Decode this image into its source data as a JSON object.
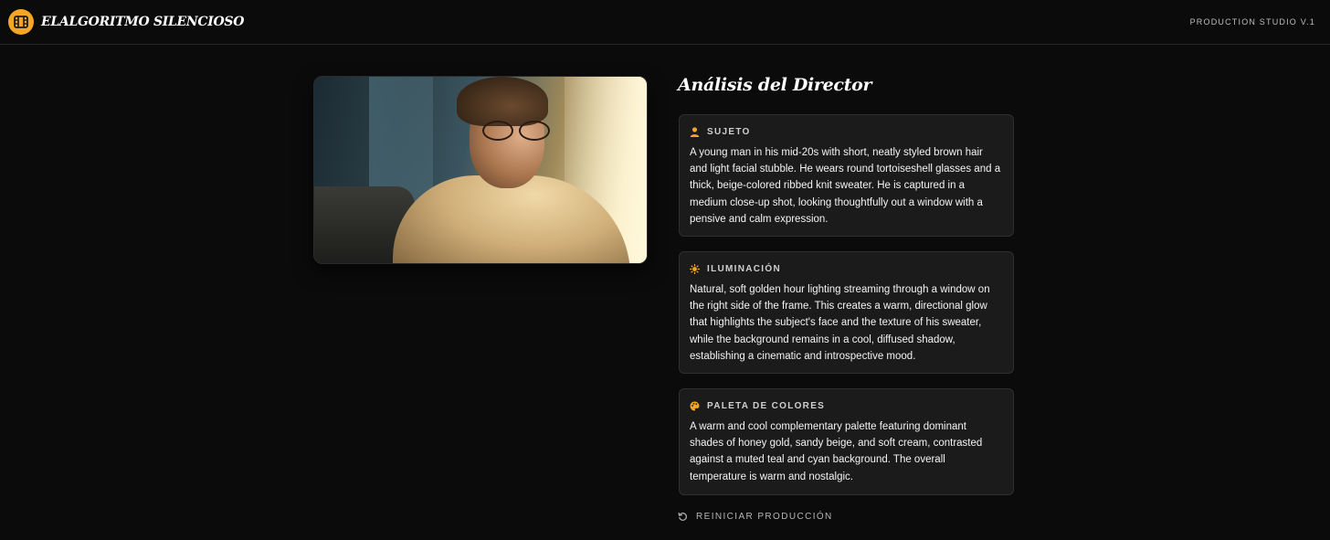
{
  "header": {
    "brand": "ELALGORITMO SILENCIOSO",
    "studio_label": "PRODUCTION STUDIO V.1",
    "logo_icon": "film-icon"
  },
  "photo": {
    "icon": "portrait-photo"
  },
  "analysis": {
    "title": "Análisis del Director",
    "cards": [
      {
        "icon": "person-icon",
        "label": "SUJETO",
        "text": "A young man in his mid-20s with short, neatly styled brown hair and light facial stubble. He wears round tortoiseshell glasses and a thick, beige-colored ribbed knit sweater. He is captured in a medium close-up shot, looking thoughtfully out a window with a pensive and calm expression."
      },
      {
        "icon": "sun-icon",
        "label": "ILUMINACIÓN",
        "text": "Natural, soft golden hour lighting streaming through a window on the right side of the frame. This creates a warm, directional glow that highlights the subject's face and the texture of his sweater, while the background remains in a cool, diffused shadow, establishing a cinematic and introspective mood."
      },
      {
        "icon": "palette-icon",
        "label": "PALETA DE COLORES",
        "text": "A warm and cool complementary palette featuring dominant shades of honey gold, sandy beige, and soft cream, contrasted against a muted teal and cyan background. The overall temperature is warm and nostalgic."
      }
    ]
  },
  "reset": {
    "label": "REINICIAR PRODUCCIÓN",
    "icon": "rotate-ccw-icon"
  },
  "colors": {
    "accent": "#f5a623",
    "background": "#0b0b0b",
    "card": "#1b1b1b"
  }
}
